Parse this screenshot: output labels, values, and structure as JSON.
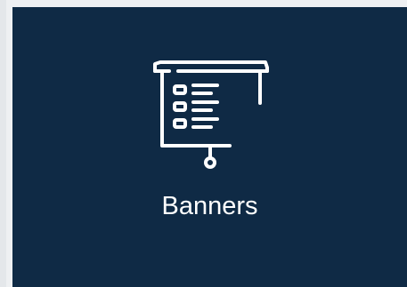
{
  "card": {
    "label": "Banners",
    "icon": "presentation-board-icon",
    "background": "#0f2a45",
    "foreground": "#ffffff"
  }
}
